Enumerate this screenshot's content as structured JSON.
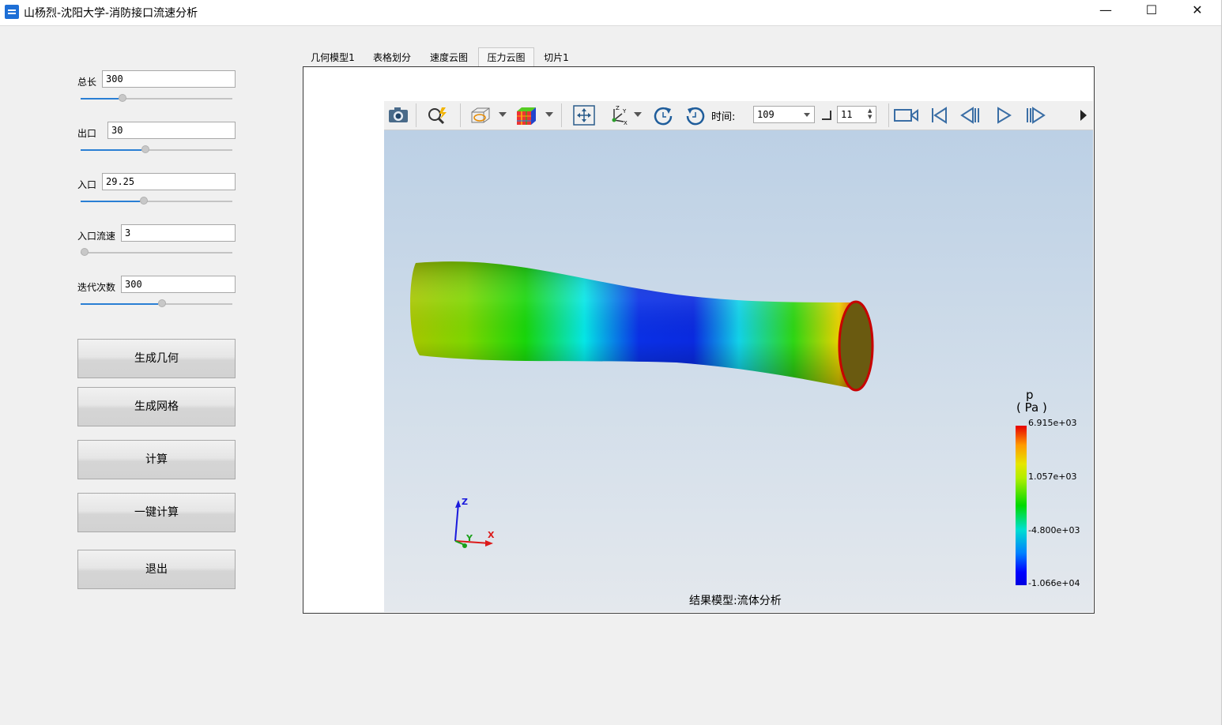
{
  "window": {
    "title": "山杨烈-沈阳大学-消防接口流速分析",
    "minimize": "—",
    "maximize": "☐",
    "close": "✕"
  },
  "params": [
    {
      "label": "总长",
      "value": "300",
      "slider": 0.25
    },
    {
      "label": "出口",
      "value": "30",
      "slider": 0.4
    },
    {
      "label": "入口",
      "value": "29.25",
      "slider": 0.39
    },
    {
      "label": "入口流速",
      "value": "3",
      "slider": 0.0
    },
    {
      "label": "迭代次数",
      "value": "300",
      "slider": 0.51
    }
  ],
  "buttons": [
    "生成几何",
    "生成网格",
    "计算",
    "一键计算",
    "退出"
  ],
  "tabs": [
    "几何模型1",
    "表格划分",
    "速度云图",
    "压力云图",
    "切片1"
  ],
  "active_tab": "压力云图",
  "toolbar": {
    "icons": [
      "camera-icon",
      "zoom-icon",
      "display-mode-icon",
      "colormap-icon",
      "fit-view-icon",
      "axis-orient-icon",
      "rotate-cw-icon",
      "rotate-ccw-icon",
      "record-icon",
      "first-frame-icon",
      "prev-frame-icon",
      "play-icon",
      "next-frame-icon",
      "more-icon"
    ],
    "time_label": "时间:",
    "time_value": "109",
    "step_value": "11"
  },
  "colorbar": {
    "var": "p",
    "unit": "( Pa )",
    "max": "6.915e+03",
    "mid_high": "1.057e+03",
    "mid_low": "-4.800e+03",
    "min": "-1.066e+04"
  },
  "axes": {
    "x": "X",
    "y": "Y",
    "z": "Z"
  },
  "caption": "结果模型:流体分析",
  "colors": {
    "accent": "#2a7fd4",
    "viewport_top": "#bcd0e5",
    "viewport_bottom": "#e4e8ed"
  }
}
